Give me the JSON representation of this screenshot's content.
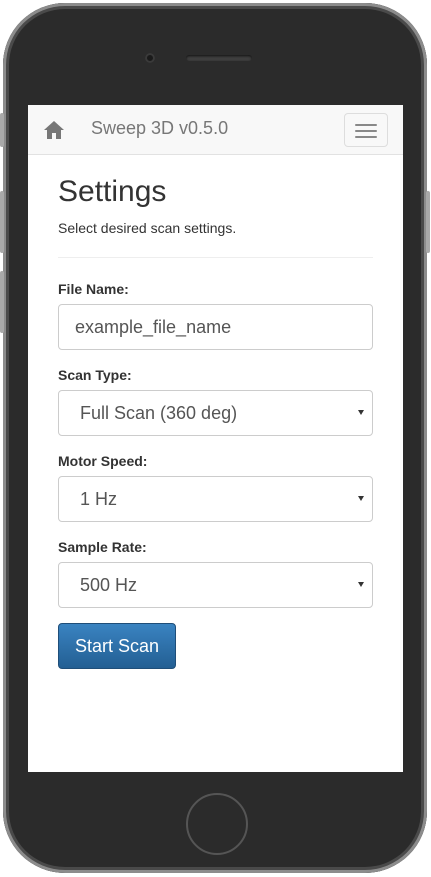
{
  "app": {
    "brand": "Sweep 3D v0.5.0"
  },
  "page": {
    "title": "Settings",
    "subtitle": "Select desired scan settings."
  },
  "form": {
    "file_name": {
      "label": "File Name:",
      "value": "example_file_name"
    },
    "scan_type": {
      "label": "Scan Type:",
      "value": "Full Scan (360 deg)"
    },
    "motor_speed": {
      "label": "Motor Speed:",
      "value": "1 Hz"
    },
    "sample_rate": {
      "label": "Sample Rate:",
      "value": "500 Hz"
    },
    "submit_label": "Start Scan"
  },
  "icons": {
    "home": "home-icon",
    "menu": "hamburger-menu-icon",
    "dropdown": "caret-down-icon"
  },
  "colors": {
    "primary": "#2a6aa3",
    "navbar_bg": "#f8f8f8",
    "device_body": "#2b2b2b"
  }
}
